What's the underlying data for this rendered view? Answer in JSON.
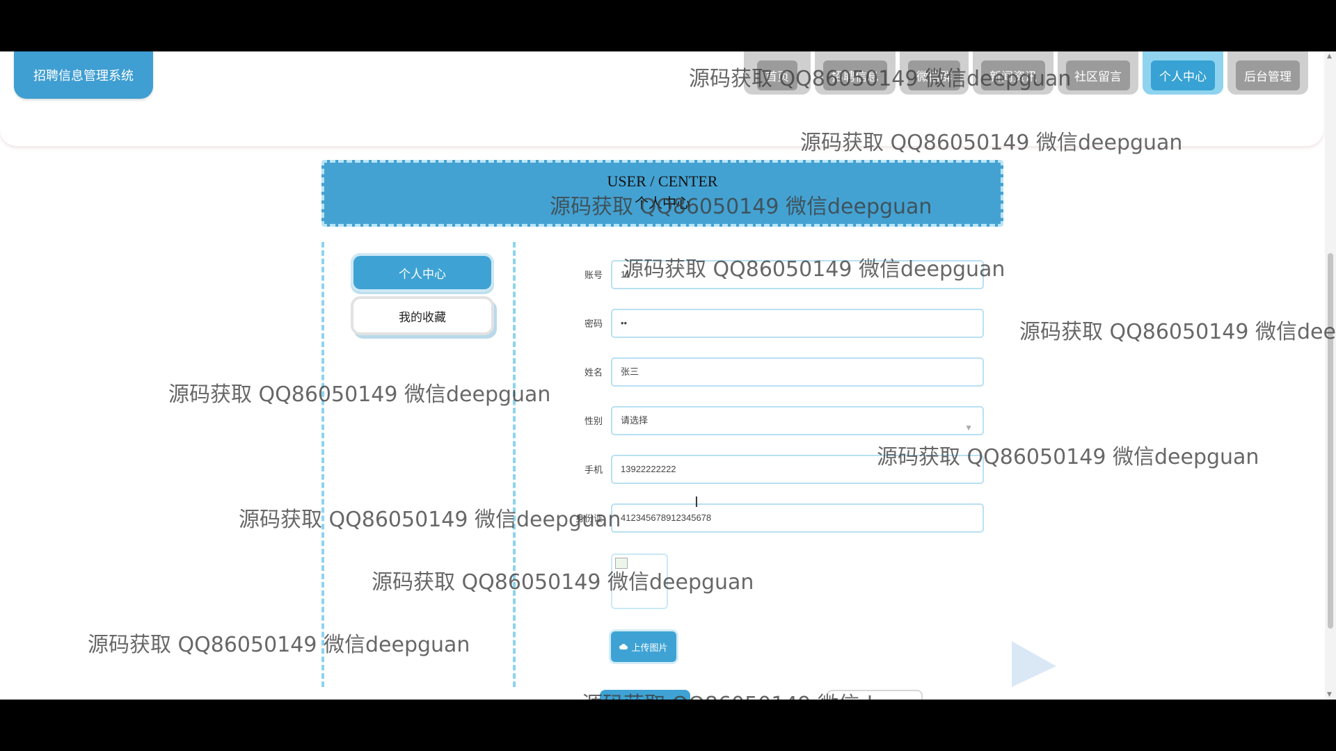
{
  "brand": {
    "title": "招聘信息管理系统"
  },
  "nav": {
    "items": [
      "首页",
      "招聘信息",
      "微信群",
      "新闻资讯",
      "社区留言",
      "个人中心",
      "后台管理"
    ],
    "active_index": 5
  },
  "banner": {
    "title_en": "USER / CENTER",
    "title_cn": "个人中心"
  },
  "sidebar": {
    "items": [
      "个人中心",
      "我的收藏"
    ]
  },
  "form": {
    "account": {
      "label": "账号",
      "value": "11"
    },
    "password": {
      "label": "密码",
      "value": "••"
    },
    "name": {
      "label": "姓名",
      "value": "张三"
    },
    "gender": {
      "label": "性别",
      "placeholder": "请选择"
    },
    "phone": {
      "label": "手机",
      "value": "13922222222"
    },
    "id_card": {
      "label": "身份证",
      "value": "412345678912345678"
    },
    "upload_label": "上传图片"
  },
  "watermark": "源码获取 QQ86050149 微信deepguan",
  "colors": {
    "primary": "#3ea3d4",
    "nav_inactive": "#9b9b9b"
  }
}
